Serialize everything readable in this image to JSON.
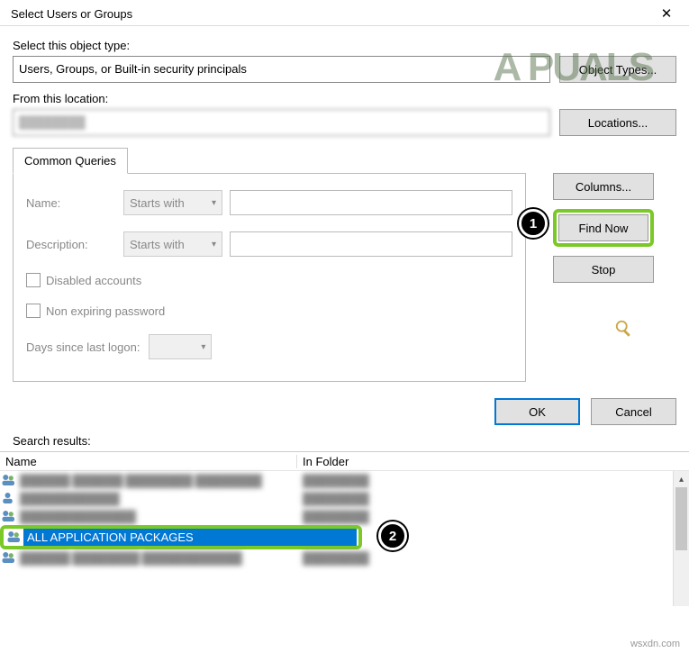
{
  "window": {
    "title": "Select Users or Groups"
  },
  "labels": {
    "object_type": "Select this object type:",
    "from_location": "From this location:",
    "search_results": "Search results:"
  },
  "fields": {
    "object_type_value": "Users, Groups, or Built-in security principals",
    "location_value": "████████"
  },
  "buttons": {
    "object_types": "Object Types...",
    "locations": "Locations...",
    "columns": "Columns...",
    "find_now": "Find Now",
    "stop": "Stop",
    "ok": "OK",
    "cancel": "Cancel"
  },
  "tab": {
    "label": "Common Queries"
  },
  "queries": {
    "name_label": "Name:",
    "desc_label": "Description:",
    "starts_with": "Starts with",
    "disabled": "Disabled accounts",
    "nonexp": "Non expiring password",
    "days_since": "Days since last logon:"
  },
  "columns": {
    "name": "Name",
    "in_folder": "In Folder"
  },
  "results": [
    {
      "name": "██████ ██████ ████████ ████████",
      "folder": "████████",
      "blurred": true
    },
    {
      "name": "████████████",
      "folder": "████████",
      "blurred": true
    },
    {
      "name": "██████████████",
      "folder": "████████",
      "blurred": true
    },
    {
      "name": "ALL APPLICATION PACKAGES",
      "folder": "",
      "blurred": false,
      "selected": true
    },
    {
      "name": "██████ ████████ ████████████",
      "folder": "████████",
      "blurred": true
    }
  ],
  "annotations": {
    "step1": "1",
    "step2": "2"
  },
  "watermark": "A  PUALS",
  "attribution": "wsxdn.com"
}
